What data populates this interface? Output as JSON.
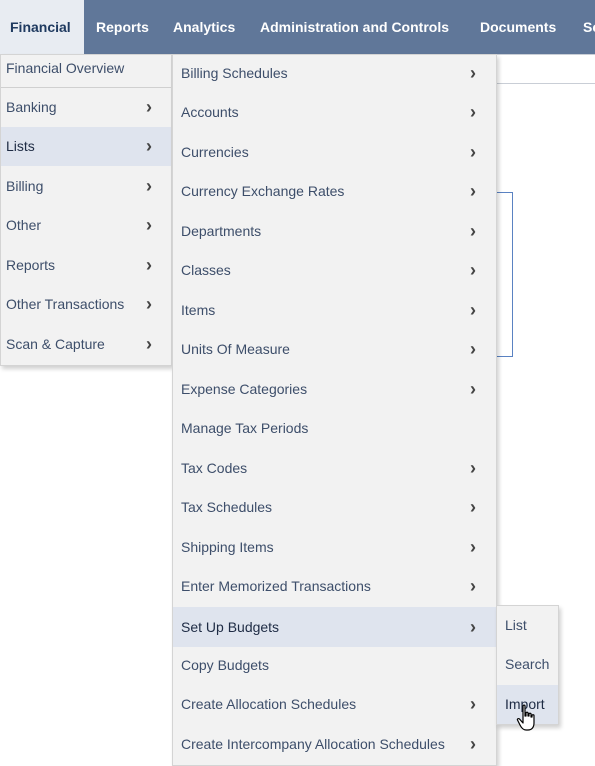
{
  "nav": {
    "tabs": [
      "Financial",
      "Reports",
      "Analytics",
      "Administration and Controls",
      "Documents",
      "Se"
    ],
    "active": "Financial"
  },
  "menu_level1": {
    "items": [
      {
        "label": "Financial Overview",
        "has_submenu": false
      },
      {
        "label": "Banking",
        "has_submenu": true
      },
      {
        "label": "Lists",
        "has_submenu": true,
        "highlighted": true
      },
      {
        "label": "Billing",
        "has_submenu": true
      },
      {
        "label": "Other",
        "has_submenu": true
      },
      {
        "label": "Reports",
        "has_submenu": true
      },
      {
        "label": "Other Transactions",
        "has_submenu": true
      },
      {
        "label": "Scan & Capture",
        "has_submenu": true
      }
    ]
  },
  "menu_level2": {
    "items": [
      {
        "label": "Billing Schedules",
        "has_submenu": true
      },
      {
        "label": "Accounts",
        "has_submenu": true
      },
      {
        "label": "Currencies",
        "has_submenu": true
      },
      {
        "label": "Currency Exchange Rates",
        "has_submenu": true
      },
      {
        "label": "Departments",
        "has_submenu": true
      },
      {
        "label": "Classes",
        "has_submenu": true
      },
      {
        "label": "Items",
        "has_submenu": true
      },
      {
        "label": "Units Of Measure",
        "has_submenu": true
      },
      {
        "label": "Expense Categories",
        "has_submenu": true
      },
      {
        "label": "Manage Tax Periods",
        "has_submenu": false
      },
      {
        "label": "Tax Codes",
        "has_submenu": true
      },
      {
        "label": "Tax Schedules",
        "has_submenu": true
      },
      {
        "label": "Shipping Items",
        "has_submenu": true
      },
      {
        "label": "Enter Memorized Transactions",
        "has_submenu": true
      },
      {
        "label": "Set Up Budgets",
        "has_submenu": true,
        "highlighted": true
      },
      {
        "label": "Copy Budgets",
        "has_submenu": false
      },
      {
        "label": "Create Allocation Schedules",
        "has_submenu": true
      },
      {
        "label": "Create Intercompany Allocation Schedules",
        "has_submenu": true
      }
    ]
  },
  "menu_level3": {
    "items": [
      {
        "label": "List"
      },
      {
        "label": "Search"
      },
      {
        "label": "Import",
        "highlighted": true
      }
    ]
  },
  "icons": {
    "submenu": "chevron-right-icon",
    "cursor": "hand-pointer-icon"
  },
  "colors": {
    "nav_bg": "#607799",
    "active_tab_bg": "#e8ecf2",
    "menu_bg": "#f2f2f2",
    "highlight_bg": "#dfe4ee",
    "menu_text": "#3d4e6a"
  }
}
